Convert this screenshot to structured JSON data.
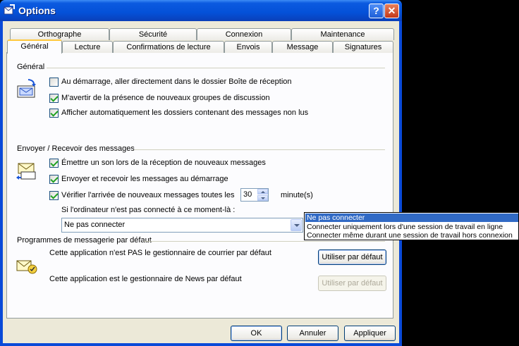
{
  "window": {
    "title": "Options"
  },
  "tabs_row1": [
    "Orthographe",
    "Sécurité",
    "Connexion",
    "Maintenance"
  ],
  "tabs_row2": [
    "Général",
    "Lecture",
    "Confirmations de lecture",
    "Envois",
    "Message",
    "Signatures"
  ],
  "active_tab": "Général",
  "general": {
    "title": "Général",
    "options": [
      {
        "label": "Au démarrage, aller directement dans le dossier Boîte de réception",
        "checked": false
      },
      {
        "label": "M'avertir de la présence de nouveaux groupes de discussion",
        "checked": true
      },
      {
        "label": "Afficher automatiquement les dossiers contenant des messages non lus",
        "checked": true
      }
    ]
  },
  "send_receive": {
    "title": "Envoyer / Recevoir des messages",
    "options": [
      {
        "label": "Émettre un son lors de la réception de nouveaux messages",
        "checked": true
      },
      {
        "label": "Envoyer et recevoir les messages au démarrage",
        "checked": true
      },
      {
        "label": "Vérifier l'arrivée de nouveaux messages toutes les",
        "checked": true
      }
    ],
    "interval_value": "30",
    "interval_unit": "minute(s)",
    "not_connected_label": "Si l'ordinateur n'est pas connecté à ce moment-là :",
    "connect_selected": "Ne pas connecter",
    "connect_options": [
      "Ne pas connecter",
      "Connecter uniquement lors d'une session de travail en ligne",
      "Connecter même durant une session de travail hors connexion"
    ]
  },
  "default_programs": {
    "title": "Programmes de messagerie par défaut",
    "mail_text": "Cette application n'est PAS le gestionnaire de courrier par défaut",
    "news_text": "Cette application est le gestionnaire de News par défaut",
    "set_default_label": "Utiliser par défaut",
    "set_default_disabled_label": "Utiliser par défaut"
  },
  "footer": {
    "ok": "OK",
    "cancel": "Annuler",
    "apply": "Appliquer"
  },
  "colors": {
    "title_bar": "#0451d8",
    "dialog_bg": "#ece9d8",
    "selection": "#316ac5",
    "active_tab_accent": "#ffc83c"
  }
}
